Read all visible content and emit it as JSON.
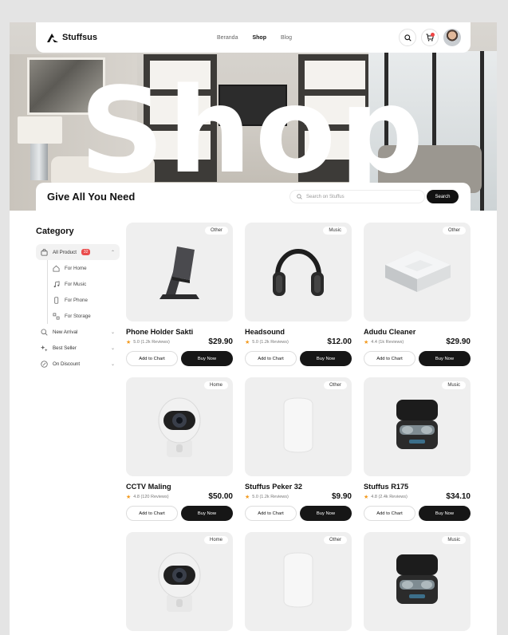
{
  "nav": {
    "brand": "Stuffsus",
    "links": [
      "Beranda",
      "Shop",
      "Blog"
    ]
  },
  "hero": {
    "title": "Shop"
  },
  "searchbar": {
    "heading": "Give All You Need",
    "placeholder": "Search on Stuffus",
    "button": "Search"
  },
  "sidebar": {
    "title": "Category",
    "all_label": "All Product",
    "all_count": "32",
    "sub_items": [
      {
        "label": "For Home",
        "icon": "home-icon"
      },
      {
        "label": "For Music",
        "icon": "music-icon"
      },
      {
        "label": "For Phone",
        "icon": "phone-icon"
      },
      {
        "label": "For Storage",
        "icon": "storage-icon"
      }
    ],
    "groups": [
      {
        "label": "New Arrival",
        "icon": "search-icon"
      },
      {
        "label": "Best Seller",
        "icon": "sparkle-icon"
      },
      {
        "label": "On Discount",
        "icon": "discount-icon"
      }
    ]
  },
  "products": [
    {
      "tag": "Other",
      "name": "Phone Holder Sakti",
      "rating": "5.0 (1.2k Reviews)",
      "price": "$29.90",
      "icon": "phone-holder"
    },
    {
      "tag": "Music",
      "name": "Headsound",
      "rating": "5.0 (1.2k Reviews)",
      "price": "$12.00",
      "icon": "headphones"
    },
    {
      "tag": "Other",
      "name": "Adudu Cleaner",
      "rating": "4.4 (1k Reviews)",
      "price": "$29.90",
      "icon": "robot-cleaner"
    },
    {
      "tag": "Home",
      "name": "CCTV Maling",
      "rating": "4.8 (120 Reviews)",
      "price": "$50.00",
      "icon": "cctv"
    },
    {
      "tag": "Other",
      "name": "Stuffus Peker 32",
      "rating": "5.0 (1.2k Reviews)",
      "price": "$9.90",
      "icon": "speaker"
    },
    {
      "tag": "Music",
      "name": "Stuffus R175",
      "rating": "4.8 (2.4k Reviews)",
      "price": "$34.10",
      "icon": "earbuds"
    },
    {
      "tag": "Home",
      "name": "",
      "rating": "",
      "price": "",
      "icon": "cctv"
    },
    {
      "tag": "Other",
      "name": "",
      "rating": "",
      "price": "",
      "icon": "speaker"
    },
    {
      "tag": "Music",
      "name": "",
      "rating": "",
      "price": "",
      "icon": "earbuds"
    }
  ],
  "buttons": {
    "add": "Add to Chart",
    "buy": "Buy Now"
  },
  "colors": {
    "accent": "#161616",
    "badge": "#ea4c4c",
    "star": "#f39a1e"
  }
}
